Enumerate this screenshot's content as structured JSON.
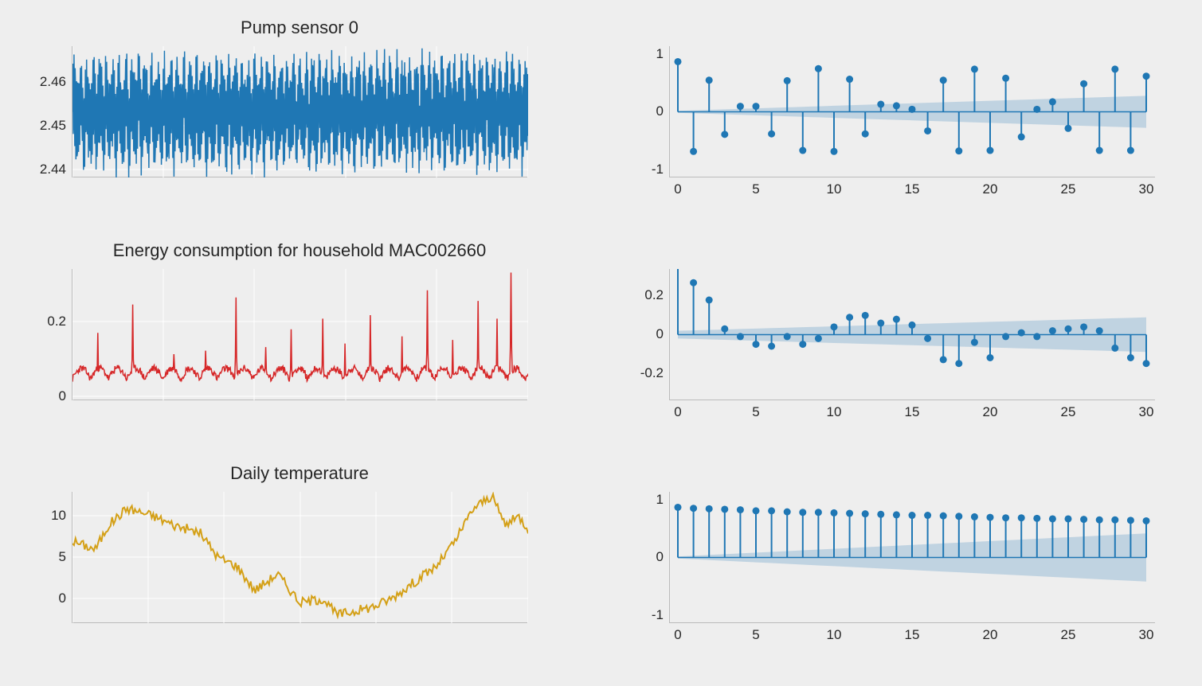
{
  "chart_data": [
    {
      "type": "line",
      "title": "Pump sensor 0",
      "yticks": [
        2.44,
        2.45,
        2.46
      ],
      "ylim": [
        2.44,
        2.47
      ],
      "color": "#1f77b4",
      "note": "dense oscillating signal ~2.44–2.47"
    },
    {
      "type": "stem-acf",
      "xticks": [
        0,
        5,
        10,
        15,
        20,
        25,
        30
      ],
      "yticks": [
        -1,
        0,
        1
      ],
      "lags": [
        0,
        1,
        2,
        3,
        4,
        5,
        6,
        7,
        8,
        9,
        10,
        11,
        12,
        13,
        14,
        15,
        16,
        17,
        18,
        19,
        20,
        21,
        22,
        23,
        24,
        25,
        26,
        27,
        28,
        29,
        30
      ],
      "values": [
        1.0,
        -0.79,
        0.63,
        -0.45,
        0.11,
        0.11,
        -0.44,
        0.62,
        -0.77,
        0.86,
        -0.79,
        0.65,
        -0.44,
        0.15,
        0.12,
        0.05,
        -0.38,
        0.63,
        -0.78,
        0.85,
        -0.77,
        0.67,
        -0.5,
        0.05,
        0.2,
        -0.33,
        0.56,
        -0.77,
        0.85,
        -0.77,
        0.71
      ],
      "conf_start": 0.02,
      "conf_end": 0.32,
      "color": "#1f77b4"
    },
    {
      "type": "line",
      "title": "Energy consumption for household MAC002660",
      "yticks": [
        0.0,
        0.2
      ],
      "ylim": [
        0.0,
        0.35
      ],
      "color": "#d62728",
      "note": "spiky series mostly 0.03–0.12 with spikes to ~0.35"
    },
    {
      "type": "stem-acf",
      "xticks": [
        0,
        5,
        10,
        15,
        20,
        25,
        30
      ],
      "yticks": [
        -0.2,
        0.0,
        0.2
      ],
      "lags": [
        0,
        1,
        2,
        3,
        4,
        5,
        6,
        7,
        8,
        9,
        10,
        11,
        12,
        13,
        14,
        15,
        16,
        17,
        18,
        19,
        20,
        21,
        22,
        23,
        24,
        25,
        26,
        27,
        28,
        29,
        30
      ],
      "values": [
        1.0,
        0.27,
        0.18,
        0.03,
        -0.01,
        -0.05,
        -0.06,
        -0.01,
        -0.05,
        -0.02,
        0.04,
        0.09,
        0.1,
        0.06,
        0.08,
        0.05,
        -0.02,
        -0.13,
        -0.15,
        -0.04,
        -0.12,
        -0.01,
        0.01,
        -0.01,
        0.02,
        0.03,
        0.04,
        0.02,
        -0.07,
        -0.12,
        -0.15
      ],
      "conf_start": 0.02,
      "conf_end": 0.09,
      "ylim": [
        -0.3,
        0.3
      ],
      "color": "#1f77b4"
    },
    {
      "type": "line",
      "title": "Daily temperature",
      "yticks": [
        0,
        5,
        10
      ],
      "ylim": [
        -3,
        13
      ],
      "color": "#d4a017",
      "note": "seasonal curve ~ -2 to 12"
    },
    {
      "type": "stem-acf",
      "xticks": [
        0,
        5,
        10,
        15,
        20,
        25,
        30
      ],
      "yticks": [
        -1,
        0,
        1
      ],
      "lags": [
        0,
        1,
        2,
        3,
        4,
        5,
        6,
        7,
        8,
        9,
        10,
        11,
        12,
        13,
        14,
        15,
        16,
        17,
        18,
        19,
        20,
        21,
        22,
        23,
        24,
        25,
        26,
        27,
        28,
        29,
        30
      ],
      "values": [
        1.0,
        0.98,
        0.97,
        0.96,
        0.95,
        0.93,
        0.93,
        0.91,
        0.9,
        0.9,
        0.89,
        0.88,
        0.87,
        0.86,
        0.85,
        0.84,
        0.84,
        0.83,
        0.82,
        0.81,
        0.8,
        0.79,
        0.79,
        0.78,
        0.77,
        0.77,
        0.76,
        0.75,
        0.75,
        0.74,
        0.73
      ],
      "conf_start": 0.02,
      "conf_end": 0.48,
      "color": "#1f77b4"
    }
  ]
}
